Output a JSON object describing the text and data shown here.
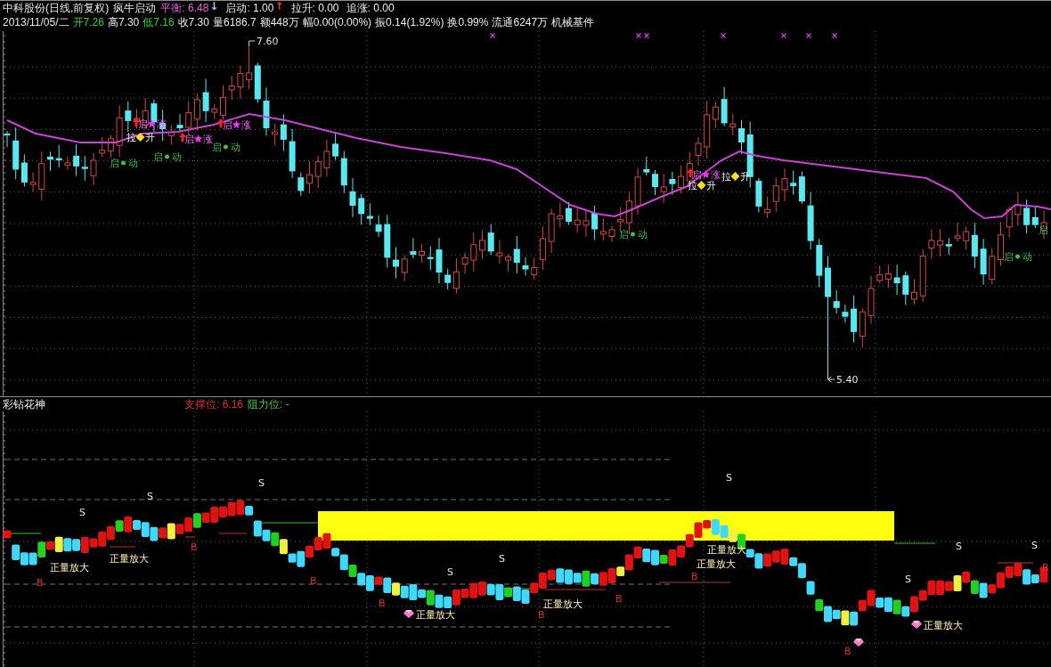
{
  "header": {
    "title": "中科股份(日线,前复权)",
    "formula": "疯牛启动",
    "indicators": [
      {
        "text": "平衡: 6.48",
        "color": "#e060e0",
        "arrow": {
          "text": "↓",
          "color": "#a8c8ff"
        }
      },
      {
        "text": "启动: 1.00",
        "color": "#e8e8e8",
        "arrow": {
          "text": "↑",
          "color": "#ff3030"
        }
      },
      {
        "text": "拉升: 0.00",
        "color": "#e8e8e8"
      },
      {
        "text": "追涨: 0.00",
        "color": "#e8e8e8"
      }
    ]
  },
  "quote": {
    "date": "2013/11/05/二",
    "fields": [
      {
        "text": "开7.26",
        "color": "#30d030"
      },
      {
        "text": "高7.30",
        "color": "#e8e8e8"
      },
      {
        "text": "低7.16",
        "color": "#30d030"
      },
      {
        "text": "收7.30",
        "color": "#e8e8e8"
      },
      {
        "text": "量6186.7",
        "color": "#e8e8e8"
      },
      {
        "text": "额448万",
        "color": "#e8e8e8"
      },
      {
        "text": "幅0.00(0.00%)",
        "color": "#e8e8e8"
      },
      {
        "text": "振0.14(1.92%)",
        "color": "#e8e8e8"
      },
      {
        "text": "换0.99%",
        "color": "#e8e8e8"
      },
      {
        "text": "流通6247万",
        "color": "#e8e8e8"
      }
    ],
    "sector": "机械基件"
  },
  "main_chart": {
    "high_label": "7.60",
    "low_label": "5.40",
    "signals": [
      {
        "kind": "start-rise",
        "left": "启",
        "right": "涨"
      },
      {
        "kind": "pull-up",
        "left": "拉",
        "right": "升"
      },
      {
        "kind": "start",
        "left": "启",
        "right": "动"
      },
      {
        "kind": "start",
        "left": "启",
        "right": "动"
      },
      {
        "kind": "start-rise",
        "left": "启",
        "right": "涨"
      },
      {
        "kind": "start",
        "left": "启",
        "right": "动"
      },
      {
        "kind": "start-rise",
        "left": "启",
        "right": "涨"
      },
      {
        "kind": "start",
        "left": "启",
        "right": "动"
      },
      {
        "kind": "start-rise",
        "left": "启",
        "right": "涨"
      },
      {
        "kind": "pull-up",
        "left": "拉",
        "right": "升"
      },
      {
        "kind": "pull-up",
        "left": "拉",
        "right": "升"
      },
      {
        "kind": "start",
        "left": "启",
        "right": "动"
      },
      {
        "kind": "start",
        "left": "启"
      }
    ]
  },
  "sub_chart": {
    "title": "彩钻花神",
    "support": "支撑位: 6.16",
    "resistance": "阻力位: -",
    "markers": [
      {
        "kind": "buy",
        "text": "B"
      },
      {
        "kind": "sell",
        "text": "S"
      },
      {
        "kind": "sell",
        "text": "S"
      },
      {
        "kind": "buy",
        "text": "B"
      },
      {
        "kind": "sell",
        "text": "S"
      },
      {
        "kind": "buy",
        "text": "B"
      },
      {
        "kind": "buy",
        "text": "B"
      },
      {
        "kind": "sell",
        "text": "S"
      },
      {
        "kind": "sell",
        "text": "S"
      },
      {
        "kind": "buy",
        "text": "B"
      },
      {
        "kind": "buy",
        "text": "B"
      },
      {
        "kind": "buy",
        "text": "B"
      },
      {
        "kind": "sell",
        "text": "S"
      },
      {
        "kind": "buy",
        "text": "B"
      },
      {
        "kind": "sell",
        "text": "S"
      },
      {
        "kind": "sell",
        "text": "S"
      },
      {
        "kind": "sell",
        "text": "S"
      },
      {
        "kind": "buy",
        "text": "B"
      }
    ],
    "volume_labels": [
      {
        "text": "正量放大",
        "gem": false
      },
      {
        "text": "正量放大",
        "gem": false
      },
      {
        "text": "正量放大",
        "gem": true
      },
      {
        "text": "正量放大",
        "gem": false
      },
      {
        "text": "正量放大",
        "gem": false
      },
      {
        "text": "正量放大",
        "gem": false
      },
      {
        "text": "正量放大",
        "gem": true
      }
    ]
  }
}
